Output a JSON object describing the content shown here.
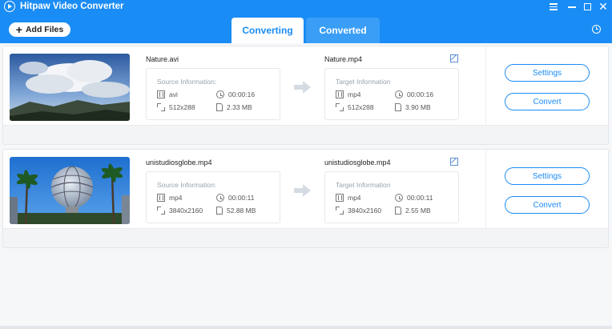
{
  "app": {
    "title": "Hitpaw Video Converter"
  },
  "toolbar": {
    "add_files": "Add Files"
  },
  "tabs": [
    {
      "label": "Converting",
      "active": true
    },
    {
      "label": "Converted",
      "active": false
    }
  ],
  "colors": {
    "accent": "#1a8cf5",
    "tab_inactive": "#3a9ef7"
  },
  "icons": [
    "app-logo-icon",
    "menu-icon",
    "minimize-icon",
    "maximize-icon",
    "close-icon",
    "plus-icon",
    "history-icon",
    "film-icon",
    "clock-icon",
    "resize-icon",
    "file-icon",
    "arrow-right-icon",
    "edit-icon"
  ],
  "items": [
    {
      "source_name": "Nature.avi",
      "target_name": "Nature.mp4",
      "source": {
        "heading": "Source Information:",
        "format": "avi",
        "duration": "00:00:16",
        "resolution": "512x288",
        "size": "2.33 MB"
      },
      "target": {
        "heading": "Target Information",
        "format": "mp4",
        "duration": "00:00:16",
        "resolution": "512x288",
        "size": "3.90 MB"
      },
      "settings_label": "Settings",
      "convert_label": "Convert"
    },
    {
      "source_name": "unistudiosglobe.mp4",
      "target_name": "unistudiosglobe.mp4",
      "source": {
        "heading": "Source Information:",
        "format": "mp4",
        "duration": "00:00:11",
        "resolution": "3840x2160",
        "size": "52.88 MB"
      },
      "target": {
        "heading": "Target Information",
        "format": "mp4",
        "duration": "00:00:11",
        "resolution": "3840x2160",
        "size": "2.55 MB"
      },
      "settings_label": "Settings",
      "convert_label": "Convert"
    }
  ]
}
